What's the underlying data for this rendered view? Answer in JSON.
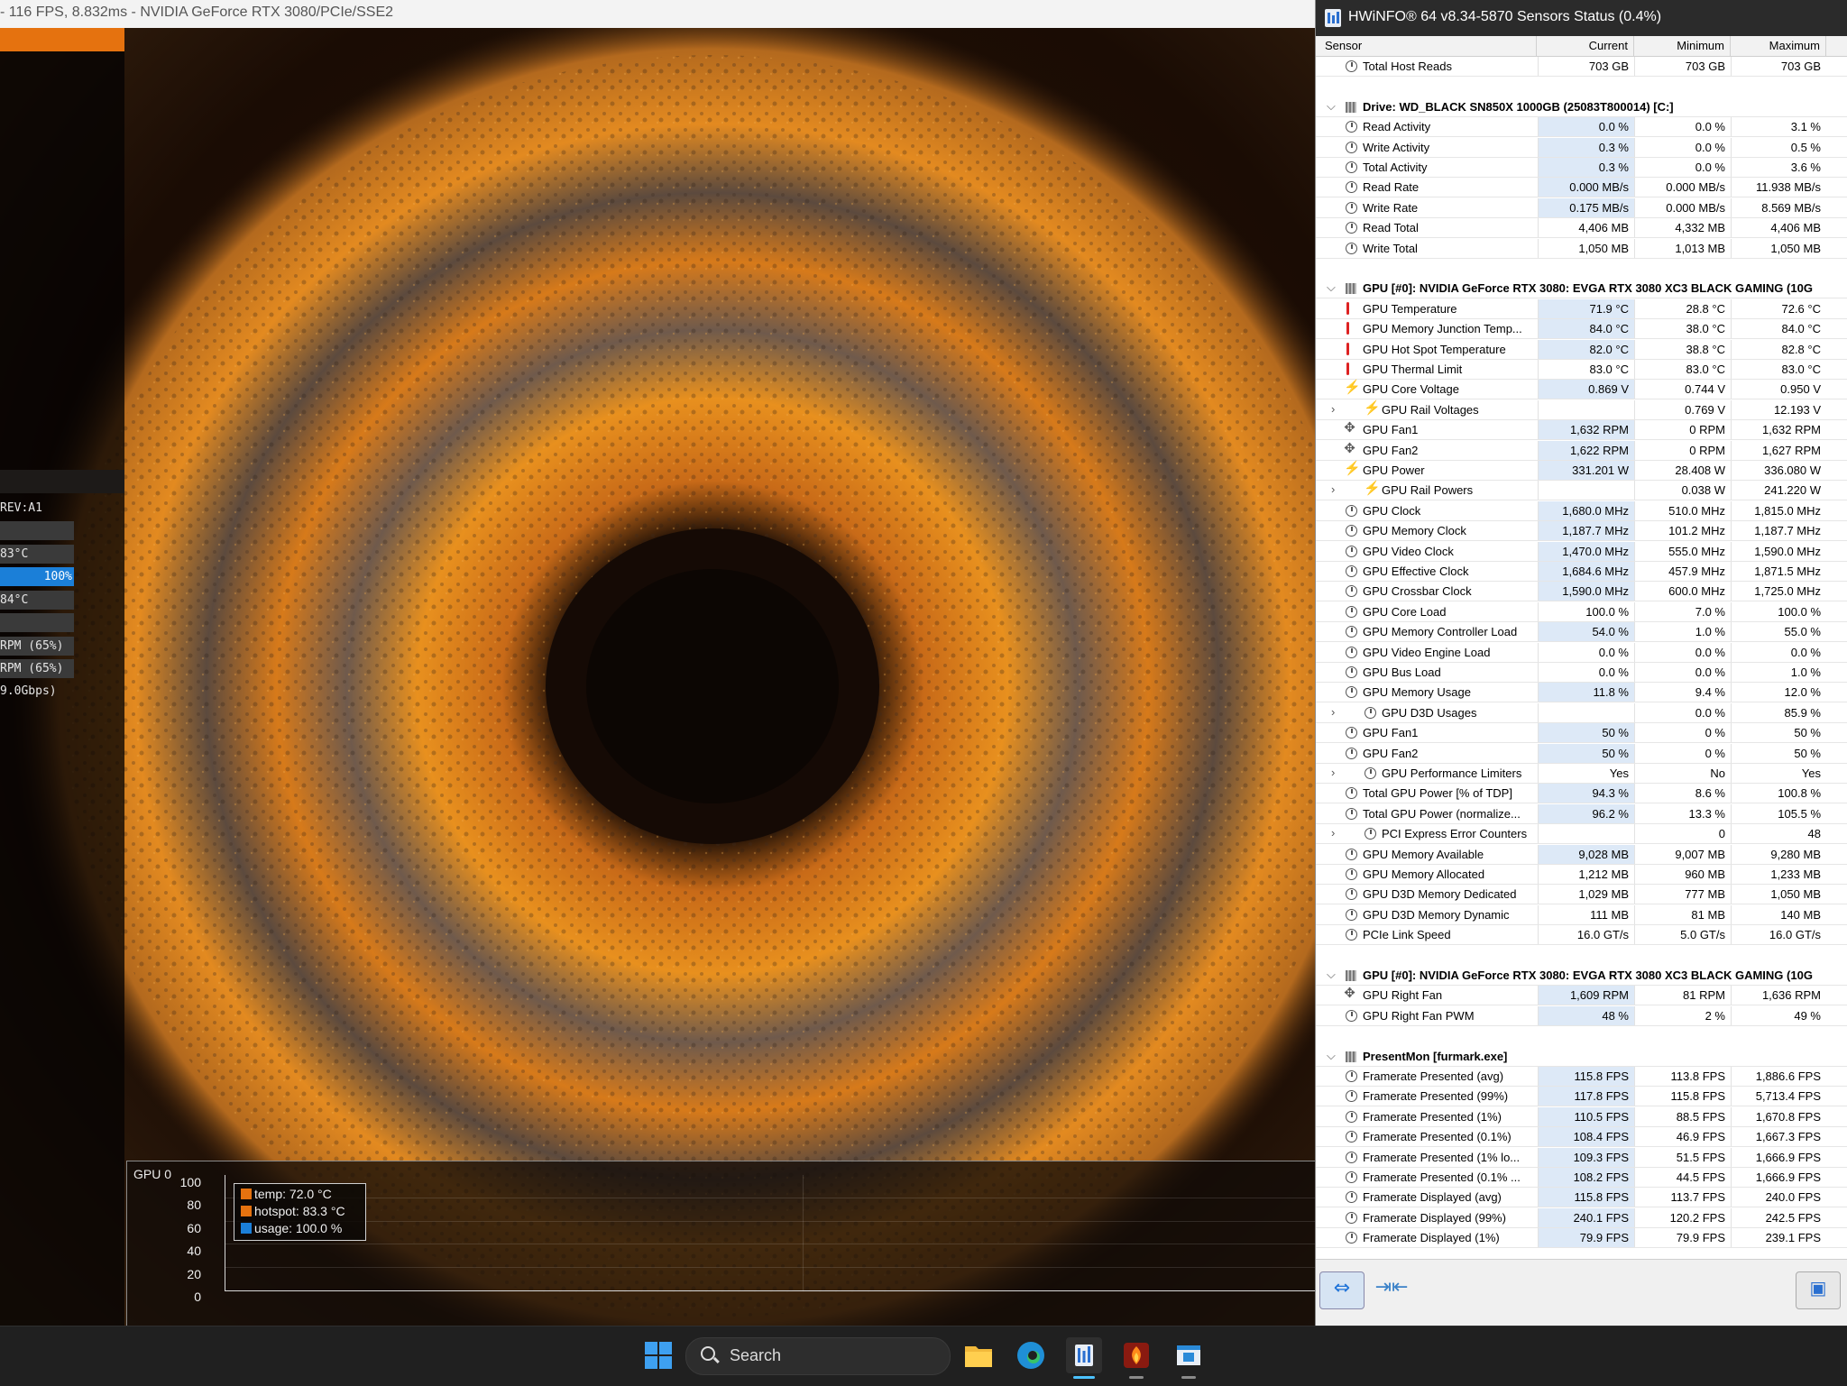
{
  "furmark": {
    "window_title": "- 116 FPS, 8.832ms - NVIDIA GeForce RTX 3080/PCIe/SSE2",
    "left_panel": {
      "rev_text": "REV:A1",
      "temp1": "83°C",
      "usage": "100%",
      "usage_fraction": 1.0,
      "temp2": "84°C",
      "fan1": " RPM (65%)",
      "fan2": " RPM (65%)",
      "mem_speed": "9.0Gbps)"
    },
    "graph": {
      "title": "GPU 0",
      "y_ticks": [
        "100",
        "80",
        "60",
        "40",
        "20",
        "0"
      ],
      "legend": [
        {
          "label": "temp: 72.0 °C",
          "color": "#e5720f"
        },
        {
          "label": "hotspot: 83.3 °C",
          "color": "#e5720f"
        },
        {
          "label": "usage: 100.0 %",
          "color": "#1b7fd8"
        }
      ]
    }
  },
  "hwinfo": {
    "title": "HWiNFO® 64 v8.34-5870 Sensors Status (0.4%)",
    "columns": {
      "sensor": "Sensor",
      "current": "Current",
      "minimum": "Minimum",
      "maximum": "Maximum"
    },
    "rows": [
      {
        "type": "sensor",
        "icon": "clock",
        "name": "Total Host Reads",
        "cur": "703 GB",
        "min": "703 GB",
        "max": "703 GB",
        "hl": false
      },
      {
        "type": "empty"
      },
      {
        "type": "group",
        "name": "Drive: WD_BLACK SN850X 1000GB (25083T800014) [C:]"
      },
      {
        "type": "sensor",
        "icon": "clock",
        "name": "Read Activity",
        "cur": "0.0 %",
        "min": "0.0 %",
        "max": "3.1 %",
        "hl": true
      },
      {
        "type": "sensor",
        "icon": "clock",
        "name": "Write Activity",
        "cur": "0.3 %",
        "min": "0.0 %",
        "max": "0.5 %",
        "hl": true
      },
      {
        "type": "sensor",
        "icon": "clock",
        "name": "Total Activity",
        "cur": "0.3 %",
        "min": "0.0 %",
        "max": "3.6 %",
        "hl": true
      },
      {
        "type": "sensor",
        "icon": "clock",
        "name": "Read Rate",
        "cur": "0.000 MB/s",
        "min": "0.000 MB/s",
        "max": "11.938 MB/s",
        "hl": true
      },
      {
        "type": "sensor",
        "icon": "clock",
        "name": "Write Rate",
        "cur": "0.175 MB/s",
        "min": "0.000 MB/s",
        "max": "8.569 MB/s",
        "hl": true
      },
      {
        "type": "sensor",
        "icon": "clock",
        "name": "Read Total",
        "cur": "4,406 MB",
        "min": "4,332 MB",
        "max": "4,406 MB",
        "hl": false
      },
      {
        "type": "sensor",
        "icon": "clock",
        "name": "Write Total",
        "cur": "1,050 MB",
        "min": "1,013 MB",
        "max": "1,050 MB",
        "hl": false
      },
      {
        "type": "empty"
      },
      {
        "type": "group",
        "name": "GPU [#0]: NVIDIA GeForce RTX 3080: EVGA RTX 3080 XC3 BLACK GAMING (10G"
      },
      {
        "type": "sensor",
        "icon": "therm",
        "name": "GPU Temperature",
        "cur": "71.9 °C",
        "min": "28.8 °C",
        "max": "72.6 °C",
        "hl": true
      },
      {
        "type": "sensor",
        "icon": "therm",
        "name": "GPU Memory Junction Temp...",
        "cur": "84.0 °C",
        "min": "38.0 °C",
        "max": "84.0 °C",
        "hl": true
      },
      {
        "type": "sensor",
        "icon": "therm",
        "name": "GPU Hot Spot Temperature",
        "cur": "82.0 °C",
        "min": "38.8 °C",
        "max": "82.8 °C",
        "hl": true
      },
      {
        "type": "sensor",
        "icon": "therm",
        "name": "GPU Thermal Limit",
        "cur": "83.0 °C",
        "min": "83.0 °C",
        "max": "83.0 °C",
        "hl": false
      },
      {
        "type": "sensor",
        "icon": "volt",
        "name": "GPU Core Voltage",
        "cur": "0.869 V",
        "min": "0.744 V",
        "max": "0.950 V",
        "hl": true
      },
      {
        "type": "sub",
        "icon": "volt",
        "name": "GPU Rail Voltages",
        "cur": "",
        "min": "0.769 V",
        "max": "12.193 V",
        "hl": false
      },
      {
        "type": "sensor",
        "icon": "fan",
        "name": "GPU Fan1",
        "cur": "1,632 RPM",
        "min": "0 RPM",
        "max": "1,632 RPM",
        "hl": true
      },
      {
        "type": "sensor",
        "icon": "fan",
        "name": "GPU Fan2",
        "cur": "1,622 RPM",
        "min": "0 RPM",
        "max": "1,627 RPM",
        "hl": true
      },
      {
        "type": "sensor",
        "icon": "volt",
        "name": "GPU Power",
        "cur": "331.201 W",
        "min": "28.408 W",
        "max": "336.080 W",
        "hl": true
      },
      {
        "type": "sub",
        "icon": "volt",
        "name": "GPU Rail Powers",
        "cur": "",
        "min": "0.038 W",
        "max": "241.220 W",
        "hl": false
      },
      {
        "type": "sensor",
        "icon": "clock",
        "name": "GPU Clock",
        "cur": "1,680.0 MHz",
        "min": "510.0 MHz",
        "max": "1,815.0 MHz",
        "hl": true
      },
      {
        "type": "sensor",
        "icon": "clock",
        "name": "GPU Memory Clock",
        "cur": "1,187.7 MHz",
        "min": "101.2 MHz",
        "max": "1,187.7 MHz",
        "hl": true
      },
      {
        "type": "sensor",
        "icon": "clock",
        "name": "GPU Video Clock",
        "cur": "1,470.0 MHz",
        "min": "555.0 MHz",
        "max": "1,590.0 MHz",
        "hl": true
      },
      {
        "type": "sensor",
        "icon": "clock",
        "name": "GPU Effective Clock",
        "cur": "1,684.6 MHz",
        "min": "457.9 MHz",
        "max": "1,871.5 MHz",
        "hl": true
      },
      {
        "type": "sensor",
        "icon": "clock",
        "name": "GPU Crossbar Clock",
        "cur": "1,590.0 MHz",
        "min": "600.0 MHz",
        "max": "1,725.0 MHz",
        "hl": true
      },
      {
        "type": "sensor",
        "icon": "clock",
        "name": "GPU Core Load",
        "cur": "100.0 %",
        "min": "7.0 %",
        "max": "100.0 %",
        "hl": false
      },
      {
        "type": "sensor",
        "icon": "clock",
        "name": "GPU Memory Controller Load",
        "cur": "54.0 %",
        "min": "1.0 %",
        "max": "55.0 %",
        "hl": true
      },
      {
        "type": "sensor",
        "icon": "clock",
        "name": "GPU Video Engine Load",
        "cur": "0.0 %",
        "min": "0.0 %",
        "max": "0.0 %",
        "hl": false
      },
      {
        "type": "sensor",
        "icon": "clock",
        "name": "GPU Bus Load",
        "cur": "0.0 %",
        "min": "0.0 %",
        "max": "1.0 %",
        "hl": false
      },
      {
        "type": "sensor",
        "icon": "clock",
        "name": "GPU Memory Usage",
        "cur": "11.8 %",
        "min": "9.4 %",
        "max": "12.0 %",
        "hl": true
      },
      {
        "type": "sub",
        "icon": "clock",
        "name": "GPU D3D Usages",
        "cur": "",
        "min": "0.0 %",
        "max": "85.9 %",
        "hl": false
      },
      {
        "type": "sensor",
        "icon": "clock",
        "name": "GPU Fan1",
        "cur": "50 %",
        "min": "0 %",
        "max": "50 %",
        "hl": true
      },
      {
        "type": "sensor",
        "icon": "clock",
        "name": "GPU Fan2",
        "cur": "50 %",
        "min": "0 %",
        "max": "50 %",
        "hl": true
      },
      {
        "type": "sub",
        "icon": "clock",
        "name": "GPU Performance Limiters",
        "cur": "Yes",
        "min": "No",
        "max": "Yes",
        "hl": false
      },
      {
        "type": "sensor",
        "icon": "clock",
        "name": "Total GPU Power [% of TDP]",
        "cur": "94.3 %",
        "min": "8.6 %",
        "max": "100.8 %",
        "hl": true
      },
      {
        "type": "sensor",
        "icon": "clock",
        "name": "Total GPU Power (normalize...",
        "cur": "96.2 %",
        "min": "13.3 %",
        "max": "105.5 %",
        "hl": true
      },
      {
        "type": "sub",
        "icon": "clock",
        "name": "PCI Express Error Counters",
        "cur": "",
        "min": "0",
        "max": "48",
        "hl": false
      },
      {
        "type": "sensor",
        "icon": "clock",
        "name": "GPU Memory Available",
        "cur": "9,028 MB",
        "min": "9,007 MB",
        "max": "9,280 MB",
        "hl": true
      },
      {
        "type": "sensor",
        "icon": "clock",
        "name": "GPU Memory Allocated",
        "cur": "1,212 MB",
        "min": "960 MB",
        "max": "1,233 MB",
        "hl": false
      },
      {
        "type": "sensor",
        "icon": "clock",
        "name": "GPU D3D Memory Dedicated",
        "cur": "1,029 MB",
        "min": "777 MB",
        "max": "1,050 MB",
        "hl": false
      },
      {
        "type": "sensor",
        "icon": "clock",
        "name": "GPU D3D Memory Dynamic",
        "cur": "111 MB",
        "min": "81 MB",
        "max": "140 MB",
        "hl": false
      },
      {
        "type": "sensor",
        "icon": "clock",
        "name": "PCIe Link Speed",
        "cur": "16.0 GT/s",
        "min": "5.0 GT/s",
        "max": "16.0 GT/s",
        "hl": false
      },
      {
        "type": "empty"
      },
      {
        "type": "group",
        "name": "GPU [#0]: NVIDIA GeForce RTX 3080: EVGA RTX 3080 XC3 BLACK GAMING (10G"
      },
      {
        "type": "sensor",
        "icon": "fan",
        "name": "GPU Right Fan",
        "cur": "1,609 RPM",
        "min": "81 RPM",
        "max": "1,636 RPM",
        "hl": true
      },
      {
        "type": "sensor",
        "icon": "clock",
        "name": "GPU Right Fan PWM",
        "cur": "48 %",
        "min": "2 %",
        "max": "49 %",
        "hl": true
      },
      {
        "type": "empty"
      },
      {
        "type": "group",
        "name": "PresentMon [furmark.exe]"
      },
      {
        "type": "sensor",
        "icon": "clock",
        "name": "Framerate Presented (avg)",
        "cur": "115.8 FPS",
        "min": "113.8 FPS",
        "max": "1,886.6 FPS",
        "hl": true
      },
      {
        "type": "sensor",
        "icon": "clock",
        "name": "Framerate Presented (99%)",
        "cur": "117.8 FPS",
        "min": "115.8 FPS",
        "max": "5,713.4 FPS",
        "hl": true
      },
      {
        "type": "sensor",
        "icon": "clock",
        "name": "Framerate Presented (1%)",
        "cur": "110.5 FPS",
        "min": "88.5 FPS",
        "max": "1,670.8 FPS",
        "hl": true
      },
      {
        "type": "sensor",
        "icon": "clock",
        "name": "Framerate Presented (0.1%)",
        "cur": "108.4 FPS",
        "min": "46.9 FPS",
        "max": "1,667.3 FPS",
        "hl": true
      },
      {
        "type": "sensor",
        "icon": "clock",
        "name": "Framerate Presented (1% lo...",
        "cur": "109.3 FPS",
        "min": "51.5 FPS",
        "max": "1,666.9 FPS",
        "hl": true
      },
      {
        "type": "sensor",
        "icon": "clock",
        "name": "Framerate Presented (0.1% ...",
        "cur": "108.2 FPS",
        "min": "44.5 FPS",
        "max": "1,666.9 FPS",
        "hl": true
      },
      {
        "type": "sensor",
        "icon": "clock",
        "name": "Framerate Displayed (avg)",
        "cur": "115.8 FPS",
        "min": "113.7 FPS",
        "max": "240.0 FPS",
        "hl": true
      },
      {
        "type": "sensor",
        "icon": "clock",
        "name": "Framerate Displayed (99%)",
        "cur": "240.1 FPS",
        "min": "120.2 FPS",
        "max": "242.5 FPS",
        "hl": true
      },
      {
        "type": "sensor",
        "icon": "clock",
        "name": "Framerate Displayed (1%)",
        "cur": "79.9 FPS",
        "min": "79.9 FPS",
        "max": "239.1 FPS",
        "hl": true
      }
    ]
  },
  "taskbar": {
    "search_label": "Search",
    "items": [
      "start-icon",
      "search-box",
      "file-explorer-icon",
      "edge-icon",
      "hwinfo-icon",
      "furmark-icon",
      "app-icon"
    ]
  },
  "colors": {
    "accent_orange": "#e5720f",
    "accent_blue": "#1b7fd8",
    "highlight_cell": "#dde9f7",
    "taskbar_bg": "#202020"
  }
}
